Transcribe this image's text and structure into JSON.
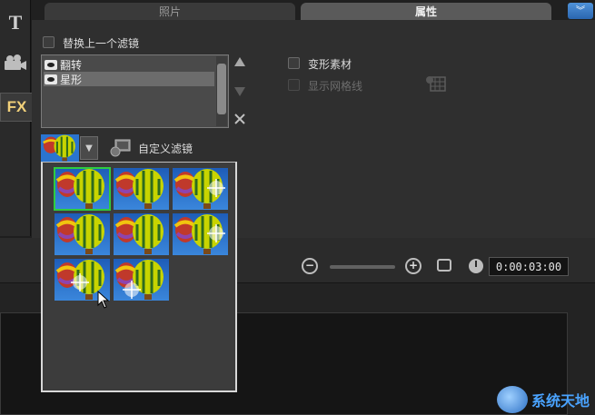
{
  "toolbar": {
    "title_tool_icon": "T",
    "fx_tool_icon": "FX"
  },
  "tabs": [
    {
      "label": "照片"
    },
    {
      "label": "属性"
    }
  ],
  "options": {
    "replace_last_filter": "替换上一个滤镜",
    "deform_clip": "变形素材",
    "show_grid": "显示网格线"
  },
  "filters": {
    "items": [
      {
        "label": "翻转"
      },
      {
        "label": "星形"
      }
    ]
  },
  "custom_filter": {
    "label": "自定义滤镜"
  },
  "preview": {
    "timecode": "0:00:03:00"
  },
  "presets": {
    "count": 8,
    "selected_index": 0
  },
  "watermark": {
    "text": "系统天地"
  },
  "icons": {
    "collapse": "double-chevron-down-icon",
    "move_up": "triangle-up-icon",
    "move_down": "triangle-down-icon",
    "remove": "close-icon",
    "grid": "grid-icon",
    "zoom_out": "zoom-out-icon",
    "zoom_in": "zoom-in-icon",
    "fit": "fit-to-window-icon",
    "clock": "clock-icon"
  },
  "colors": {
    "accent_blue": "#2a66b1",
    "selected_green": "#2ecc40"
  }
}
